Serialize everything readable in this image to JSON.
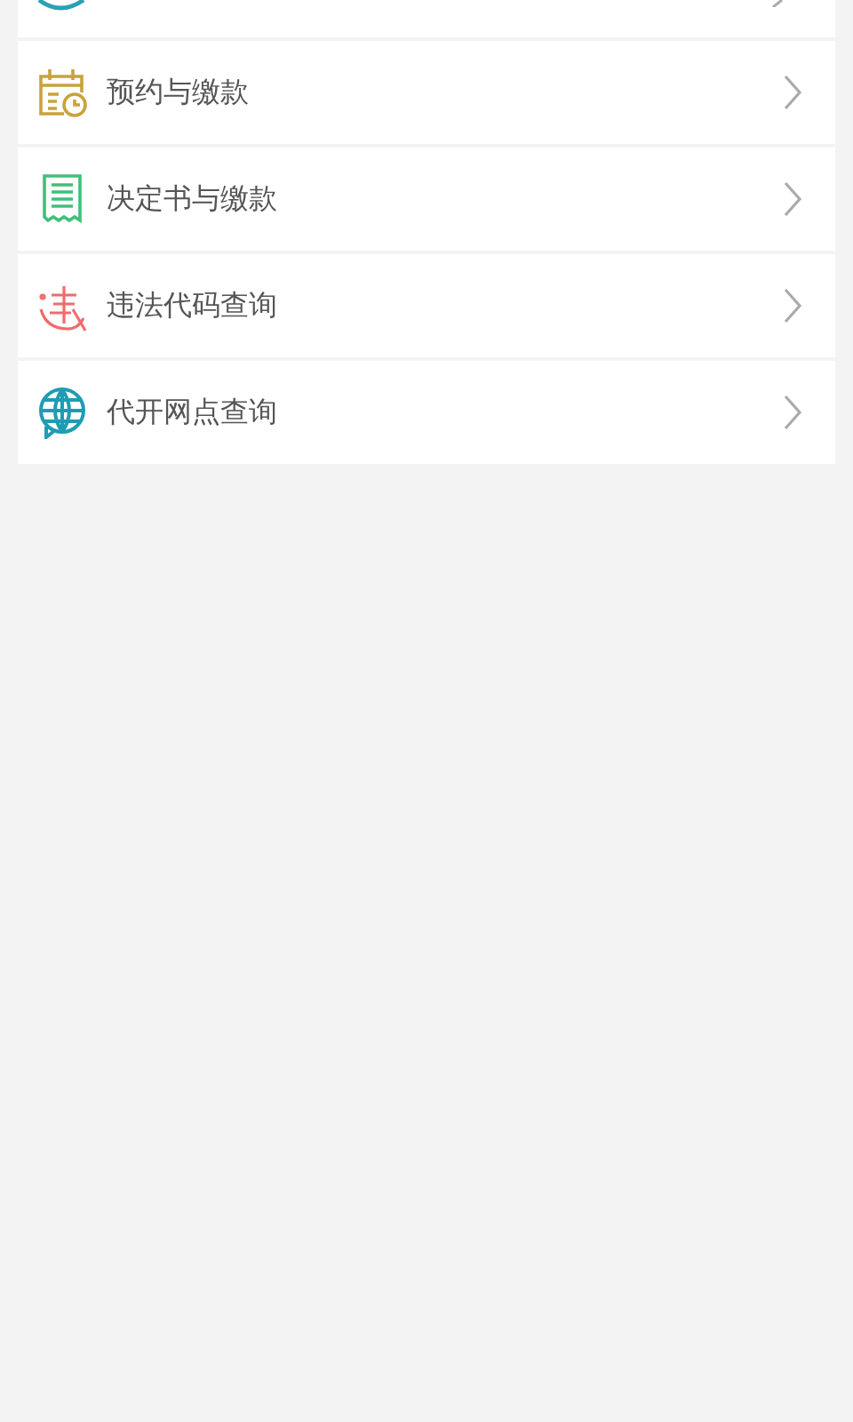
{
  "menu": {
    "items": [
      {
        "label": "预约与缴款"
      },
      {
        "label": "决定书与缴款"
      },
      {
        "label": "违法代码查询"
      },
      {
        "label": "代开网点查询"
      }
    ]
  }
}
